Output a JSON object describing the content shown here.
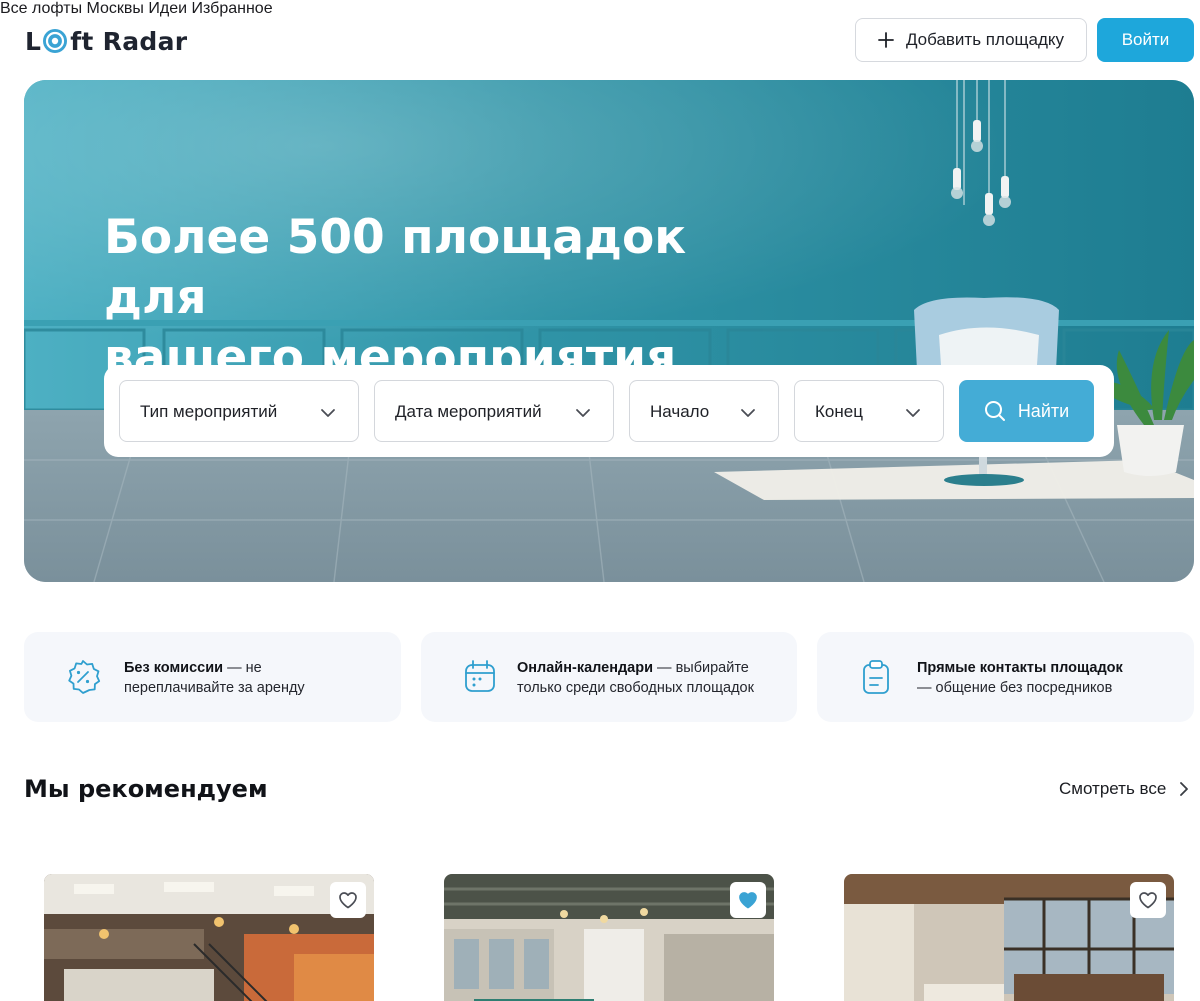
{
  "header": {
    "logo_text_before": "L",
    "logo_text_after": "ft Radar",
    "nav": [
      {
        "label": "Все лофты Москвы"
      },
      {
        "label": "Идеи"
      },
      {
        "label": "Избранное"
      }
    ],
    "add_label": "Добавить площадку",
    "login_label": "Войти",
    "accent_color": "#1ea7db"
  },
  "hero": {
    "title_line1": "Более 500 площадок для",
    "title_line2": "вашего мероприятия",
    "filters": {
      "event_type": "Тип мероприятий",
      "event_date": "Дата мероприятий",
      "start": "Начало",
      "end": "Конец"
    },
    "find_label": "Найти"
  },
  "features": [
    {
      "icon": "discount-badge-icon",
      "bold": "Без комиссии",
      "rest": " — не",
      "line2": "переплачивайте за аренду"
    },
    {
      "icon": "calendar-icon",
      "bold": "Онлайн-календари",
      "rest": " — выбирайте",
      "line2": "только среди свободных площадок"
    },
    {
      "icon": "clipboard-icon",
      "bold": "Прямые контакты площадок",
      "rest": "",
      "line2": "— общение без посредников"
    }
  ],
  "recommend": {
    "title": "Мы рекомендуем",
    "see_all": "Смотреть все",
    "cards": [
      {
        "favorited": false
      },
      {
        "favorited": true
      },
      {
        "favorited": false
      }
    ]
  }
}
